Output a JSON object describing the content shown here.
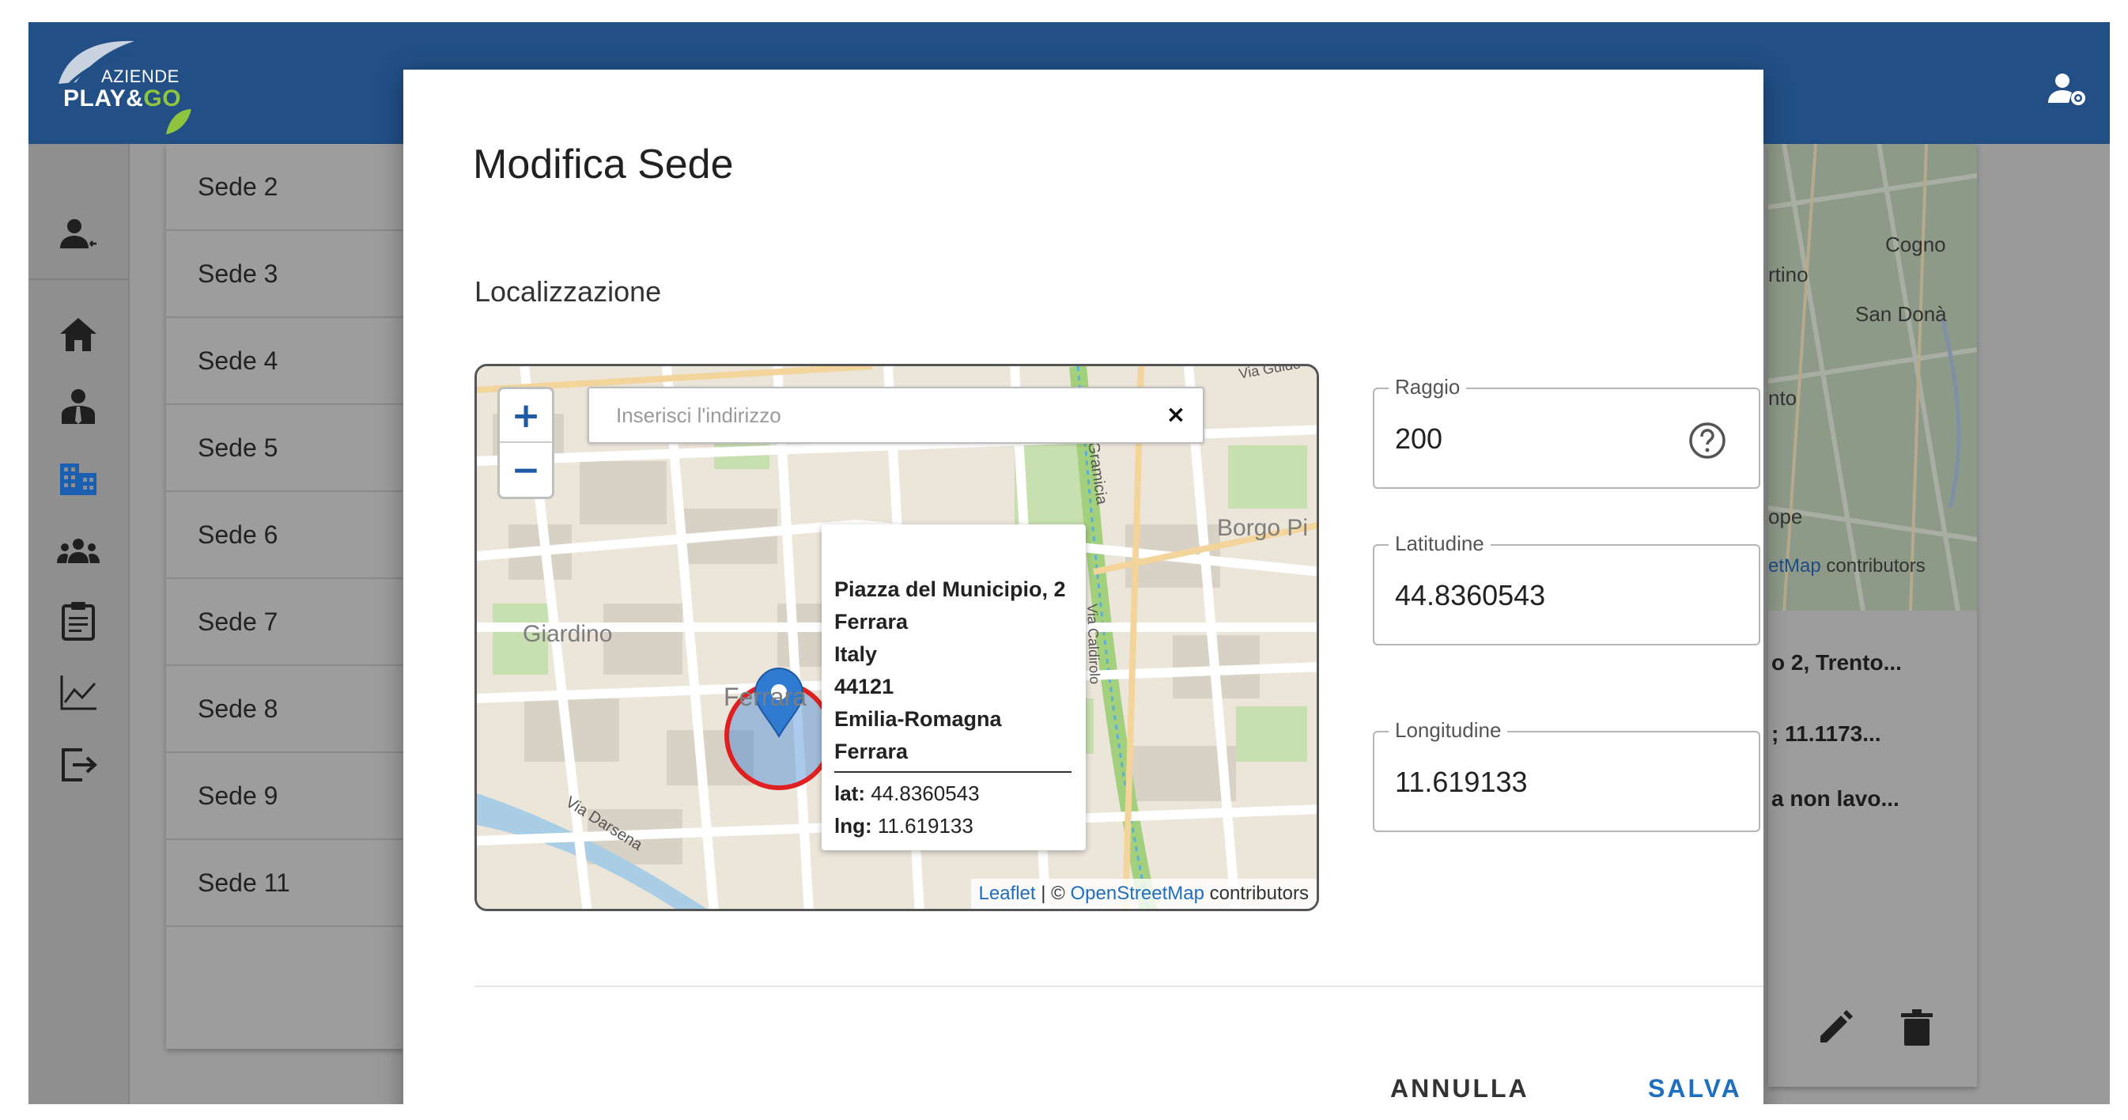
{
  "app": {
    "logo": {
      "line1": "AZIENDE",
      "play": "PLAY&",
      "go": "GO"
    },
    "colors": {
      "header": "#214f86",
      "accent": "#1f6fc0",
      "logo_green": "#8fc43f",
      "marker": "#2f7bd1",
      "circle": "#e02020"
    },
    "header_icons": {
      "admin": "manage-accounts-icon"
    },
    "sidebar_icons": [
      "person-switch-icon",
      "home-icon",
      "employee-icon",
      "company-icon",
      "groups-icon",
      "clipboard-icon",
      "chart-icon",
      "logout-icon"
    ]
  },
  "background": {
    "sedi": [
      "Sede 2",
      "Sede 3",
      "Sede 4",
      "Sede 5",
      "Sede 6",
      "Sede 7",
      "Sede 8",
      "Sede 9",
      "Sede 11"
    ],
    "detail": {
      "map_labels": [
        "Cogno",
        "rtino",
        "San Donà",
        "nto",
        "ope"
      ],
      "attribution_prefix": "etMap",
      "attribution_suffix": " contributors",
      "lines": [
        "o 2, Trento...",
        "; 11.1173...",
        "a non lavo..."
      ]
    }
  },
  "dialog": {
    "title": "Modifica Sede",
    "section": "Localizzazione",
    "map": {
      "zoom_in": "+",
      "zoom_out": "−",
      "search_placeholder": "Inserisci l'indirizzo",
      "search_clear": "×",
      "labels": {
        "giardino": "Giardino",
        "borgo": "Borgo Pi",
        "ferrara": "Ferrara",
        "caldirolo": "Via Caldirolo",
        "darsena": "Via Darsena",
        "gramicia": "Gramicia",
        "guido": "Via Guido G"
      },
      "popup": {
        "address": "Piazza del Municipio, 2",
        "city": "Ferrara",
        "country": "Italy",
        "postcode": "44121",
        "region": "Emilia-Romagna",
        "province": "Ferrara",
        "lat_label": "lat:",
        "lat_value": " 44.8360543",
        "lng_label": "lng:",
        "lng_value": " 11.619133"
      },
      "attribution": {
        "leaflet": "Leaflet",
        "sep": " | © ",
        "osm": "OpenStreetMap",
        "contributors": " contributors"
      }
    },
    "fields": {
      "raggio": {
        "label": "Raggio",
        "value": "200"
      },
      "latitudine": {
        "label": "Latitudine",
        "value": "44.8360543"
      },
      "longitudine": {
        "label": "Longitudine",
        "value": "11.619133"
      }
    },
    "buttons": {
      "cancel": "ANNULLA",
      "save": "SALVA"
    }
  }
}
